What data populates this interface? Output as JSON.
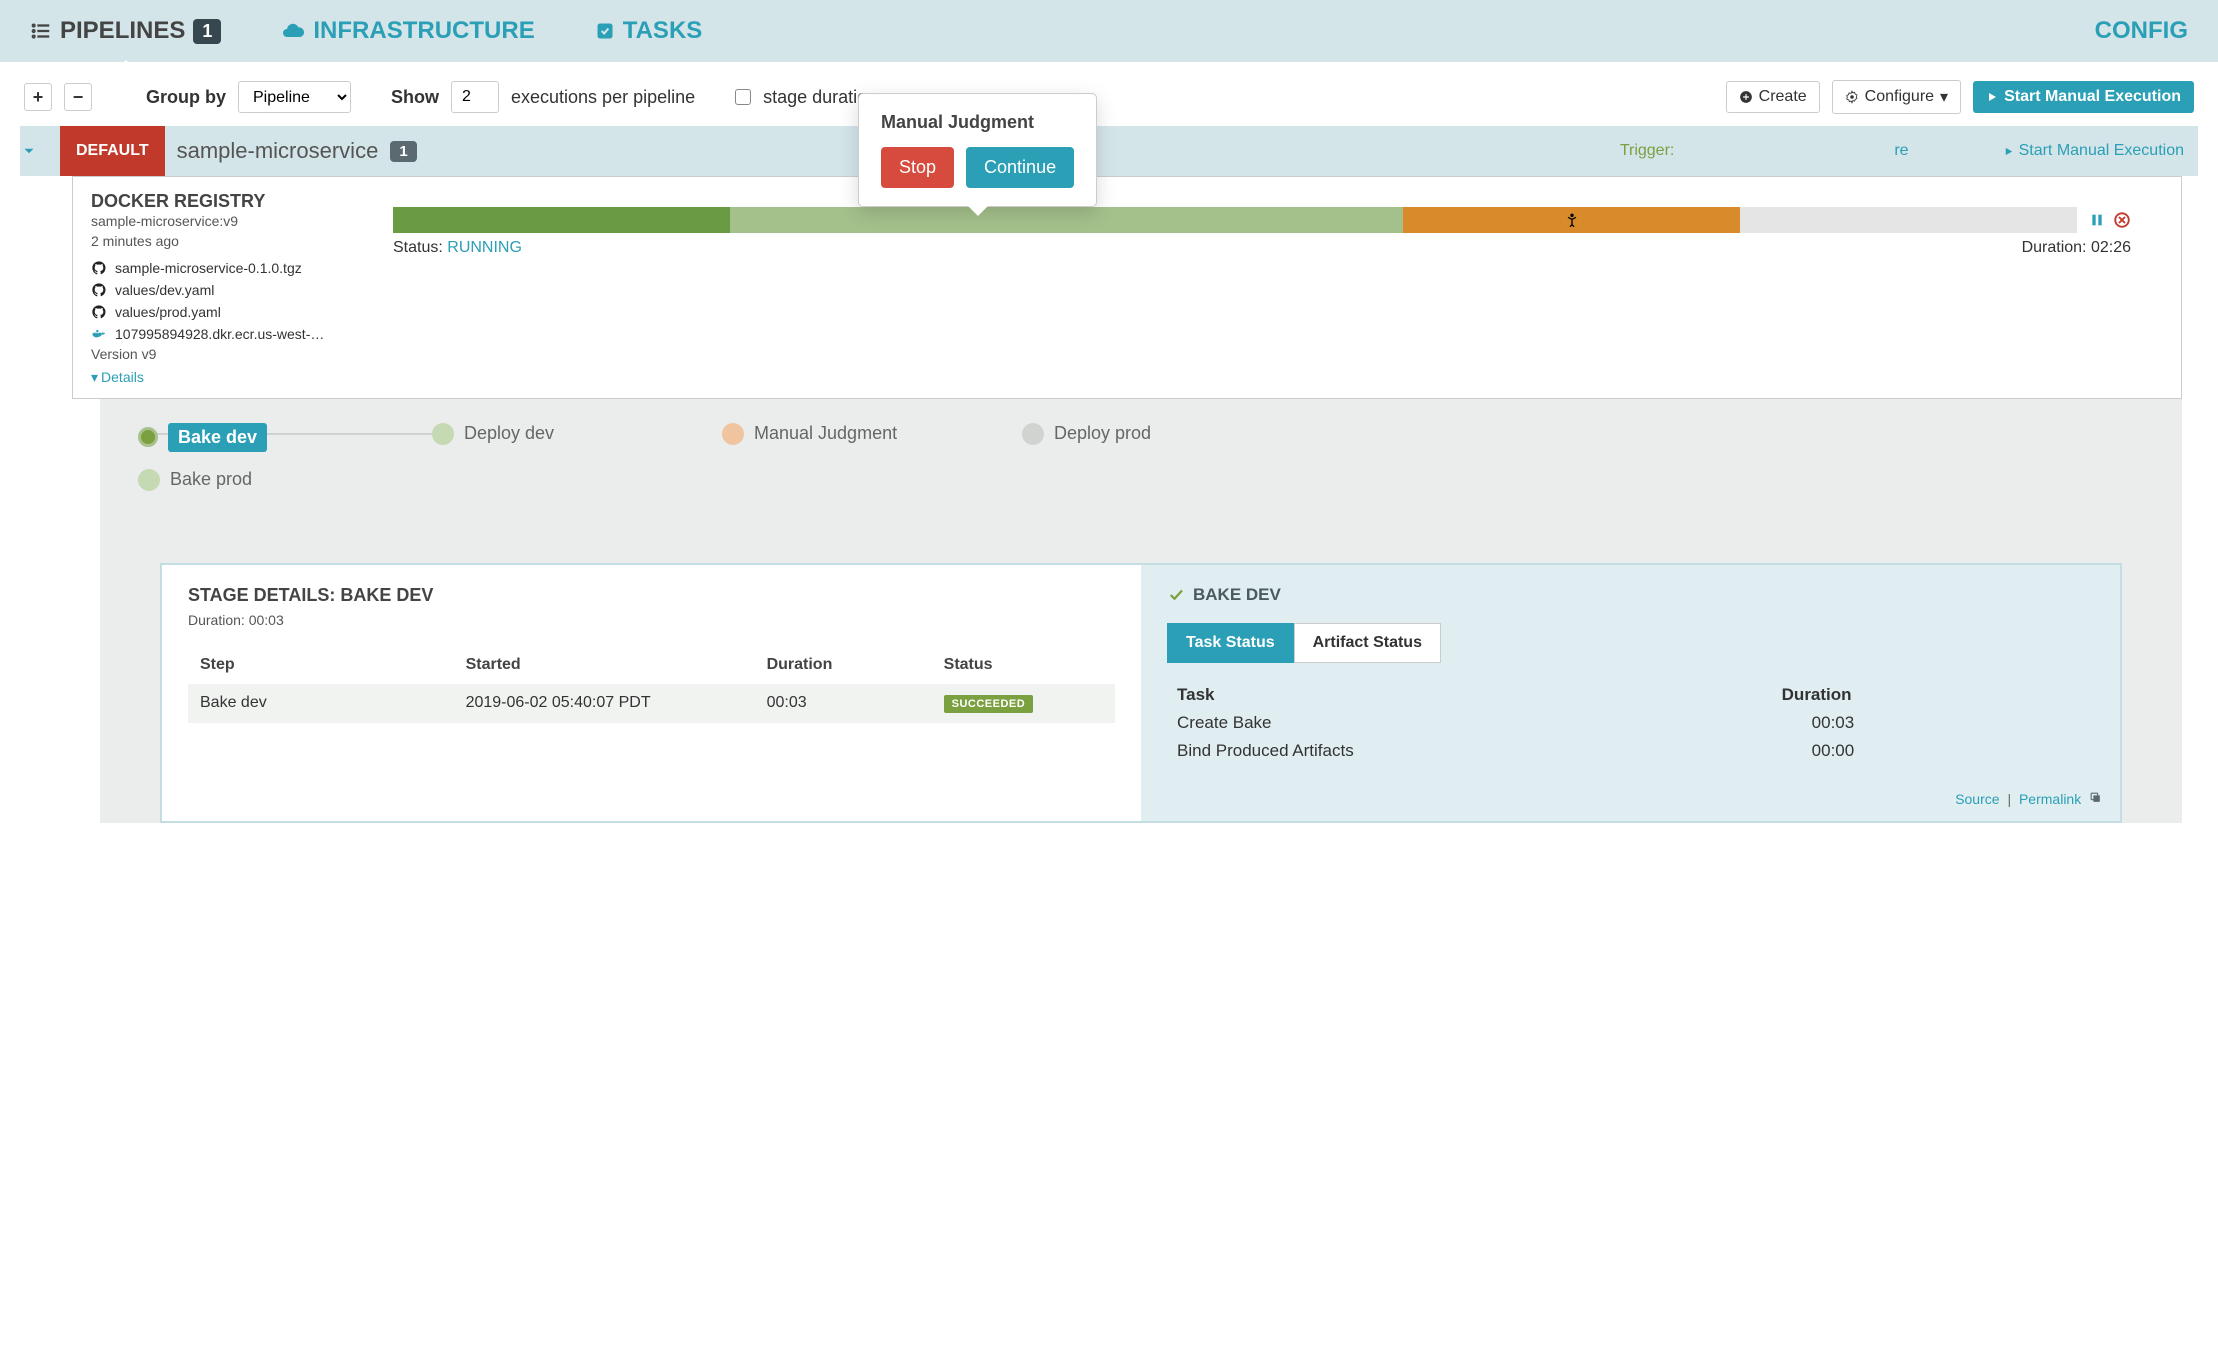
{
  "tabs": {
    "pipelines": "PIPELINES",
    "pipelines_count": "1",
    "infrastructure": "INFRASTRUCTURE",
    "tasks": "TASKS",
    "config": "CONFIG"
  },
  "toolbar": {
    "group_by_label": "Group by",
    "group_by_value": "Pipeline",
    "show_label": "Show",
    "show_value": "2",
    "executions_per": "executions per pipeline",
    "stage_durations": "stage durations",
    "create": "Create",
    "configure": "Configure",
    "start_manual": "Start Manual Execution"
  },
  "pipeline": {
    "default": "DEFAULT",
    "name": "sample-microservice",
    "count": "1",
    "triggers": "Trigger:",
    "configure": "re",
    "start_manual": "Start Manual Execution"
  },
  "exec": {
    "title": "DOCKER REGISTRY",
    "sub1": "sample-microservice:v9",
    "sub2": "2 minutes ago",
    "artifacts": [
      "sample-microservice-0.1.0.tgz",
      "values/dev.yaml",
      "values/prod.yaml",
      "107995894928.dkr.ecr.us-west-…"
    ],
    "version_label": "Version",
    "version": "v9",
    "details": "Details",
    "status_label": "Status:",
    "status": "RUNNING",
    "duration_label": "Duration:",
    "duration": "02:26"
  },
  "popover": {
    "title": "Manual Judgment",
    "stop": "Stop",
    "continue": "Continue"
  },
  "stages": {
    "bake_dev": "Bake dev",
    "deploy_dev": "Deploy dev",
    "manual_judgment": "Manual Judgment",
    "deploy_prod": "Deploy prod",
    "bake_prod": "Bake prod"
  },
  "details": {
    "title": "STAGE DETAILS: BAKE DEV",
    "duration_label": "Duration:",
    "duration": "00:03",
    "cols": {
      "step": "Step",
      "started": "Started",
      "duration": "Duration",
      "status": "Status"
    },
    "row": {
      "step": "Bake dev",
      "started": "2019-06-02 05:40:07 PDT",
      "duration": "00:03",
      "status": "SUCCEEDED"
    },
    "right_title": "BAKE DEV",
    "tabs": {
      "task_status": "Task Status",
      "artifact_status": "Artifact Status"
    },
    "task_cols": {
      "task": "Task",
      "duration": "Duration"
    },
    "tasks": [
      {
        "name": "Create Bake",
        "dur": "00:03"
      },
      {
        "name": "Bind Produced Artifacts",
        "dur": "00:00"
      }
    ],
    "source": "Source",
    "permalink": "Permalink"
  }
}
